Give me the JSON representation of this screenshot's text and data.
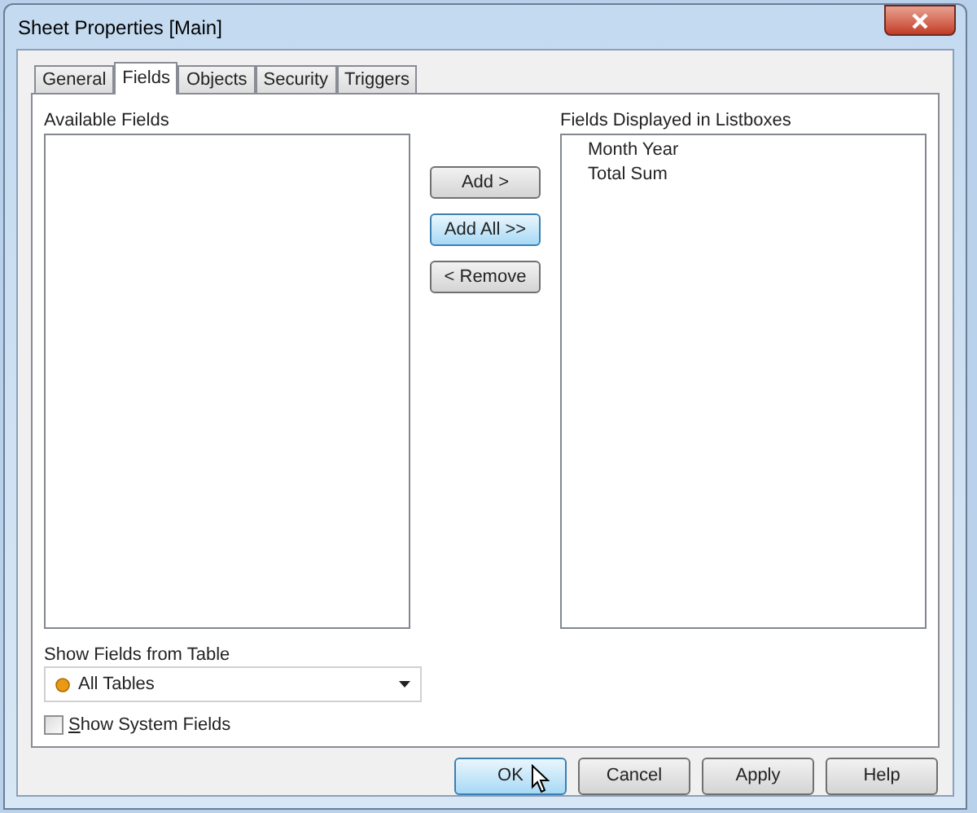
{
  "window": {
    "title": "Sheet Properties [Main]"
  },
  "tabs": [
    {
      "label": "General",
      "selected": false
    },
    {
      "label": "Fields",
      "selected": true
    },
    {
      "label": "Objects",
      "selected": false
    },
    {
      "label": "Security",
      "selected": false
    },
    {
      "label": "Triggers",
      "selected": false
    }
  ],
  "available_fields": {
    "label": "Available Fields"
  },
  "move_buttons": [
    {
      "label": "Add >",
      "highlighted": false
    },
    {
      "label": "Add All >>",
      "highlighted": true
    },
    {
      "label": "< Remove",
      "highlighted": false
    }
  ],
  "displayed_fields": {
    "label": "Fields Displayed in Listboxes",
    "items": [
      "Month Year",
      "Total Sum"
    ]
  },
  "table_filter": {
    "label": "Show Fields from Table",
    "value": "All Tables"
  },
  "show_system_fields": {
    "label": "Show System Fields",
    "checked": false
  },
  "dialog_buttons": [
    {
      "label": "OK",
      "highlighted": true
    },
    {
      "label": "Cancel",
      "highlighted": false
    },
    {
      "label": "Apply",
      "highlighted": false
    },
    {
      "label": "Help",
      "highlighted": false
    }
  ]
}
